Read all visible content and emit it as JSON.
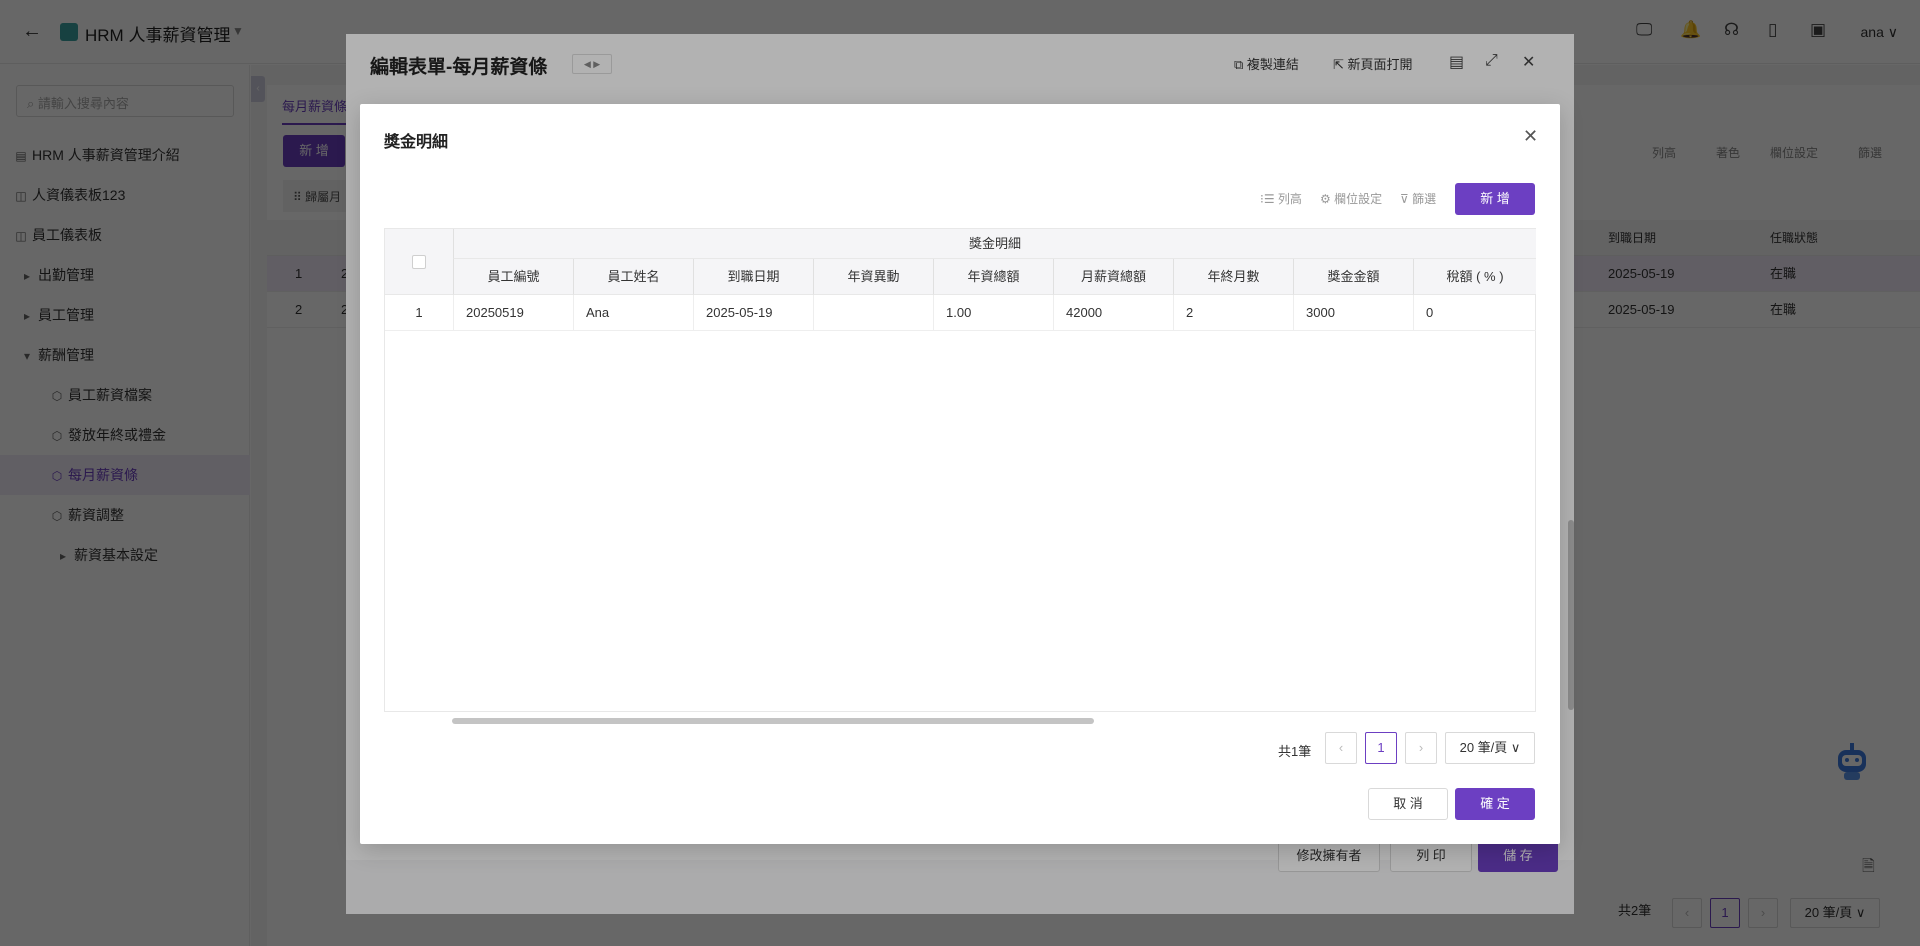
{
  "topbar": {
    "back_icon": "arrow-left-icon",
    "app_title": "HRM 人事薪資管理",
    "user": "ana ∨"
  },
  "sidebar": {
    "search_placeholder": "請輸入搜尋內容",
    "items": [
      {
        "label": "HRM 人事薪資管理介紹",
        "icon": "table-icon"
      },
      {
        "label": "人資儀表板123",
        "icon": "dashboard-icon"
      },
      {
        "label": "員工儀表板",
        "icon": "dashboard-icon"
      },
      {
        "label": "出勤管理",
        "icon": "caret-right-icon"
      },
      {
        "label": "員工管理",
        "icon": "caret-right-icon"
      },
      {
        "label": "薪酬管理",
        "icon": "caret-down-icon"
      },
      {
        "label": "員工薪資檔案",
        "icon": "cube-icon"
      },
      {
        "label": "發放年終或禮金",
        "icon": "cube-icon"
      },
      {
        "label": "每月薪資條",
        "icon": "cube-icon"
      },
      {
        "label": "薪資調整",
        "icon": "cube-icon"
      },
      {
        "label": "薪資基本設定",
        "icon": "caret-right-icon"
      }
    ]
  },
  "background": {
    "tab": "每月薪資條",
    "add_button": "新 增",
    "filter_label": "歸屬月",
    "tools": [
      "列高",
      "著色",
      "欄位設定",
      "篩選"
    ],
    "columns": [
      "到職日期",
      "任職狀態"
    ],
    "rows": [
      {
        "idx": "1",
        "prefix": "2",
        "date": "2025-05-19",
        "status": "在職"
      },
      {
        "idx": "2",
        "prefix": "2",
        "date": "2025-05-19",
        "status": "在職"
      }
    ],
    "total": "共2筆",
    "page": "1",
    "page_size": "20 筆/頁 ∨"
  },
  "outer_modal": {
    "title": "編輯表單-每月薪資條",
    "copy_link": "複製連結",
    "open_new": "新頁面打開",
    "footer_buttons": [
      "修改擁有者",
      "列 印",
      "儲 存"
    ]
  },
  "modal": {
    "title": "獎金明細",
    "tools": [
      "列高",
      "欄位設定",
      "篩選"
    ],
    "add_button": "新 增",
    "group_header": "獎金明細",
    "columns": [
      "員工編號",
      "員工姓名",
      "到職日期",
      "年資異動",
      "年資總額",
      "月薪資總額",
      "年終月數",
      "獎金金額",
      "稅額 ( % )"
    ],
    "rows": [
      {
        "idx": "1",
        "cells": [
          "20250519",
          "Ana",
          "2025-05-19",
          "",
          "1.00",
          "42000",
          "2",
          "3000",
          "0"
        ]
      }
    ],
    "total": "共1筆",
    "page": "1",
    "page_size": "20 筆/頁 ∨",
    "cancel": "取 消",
    "confirm": "確 定"
  }
}
